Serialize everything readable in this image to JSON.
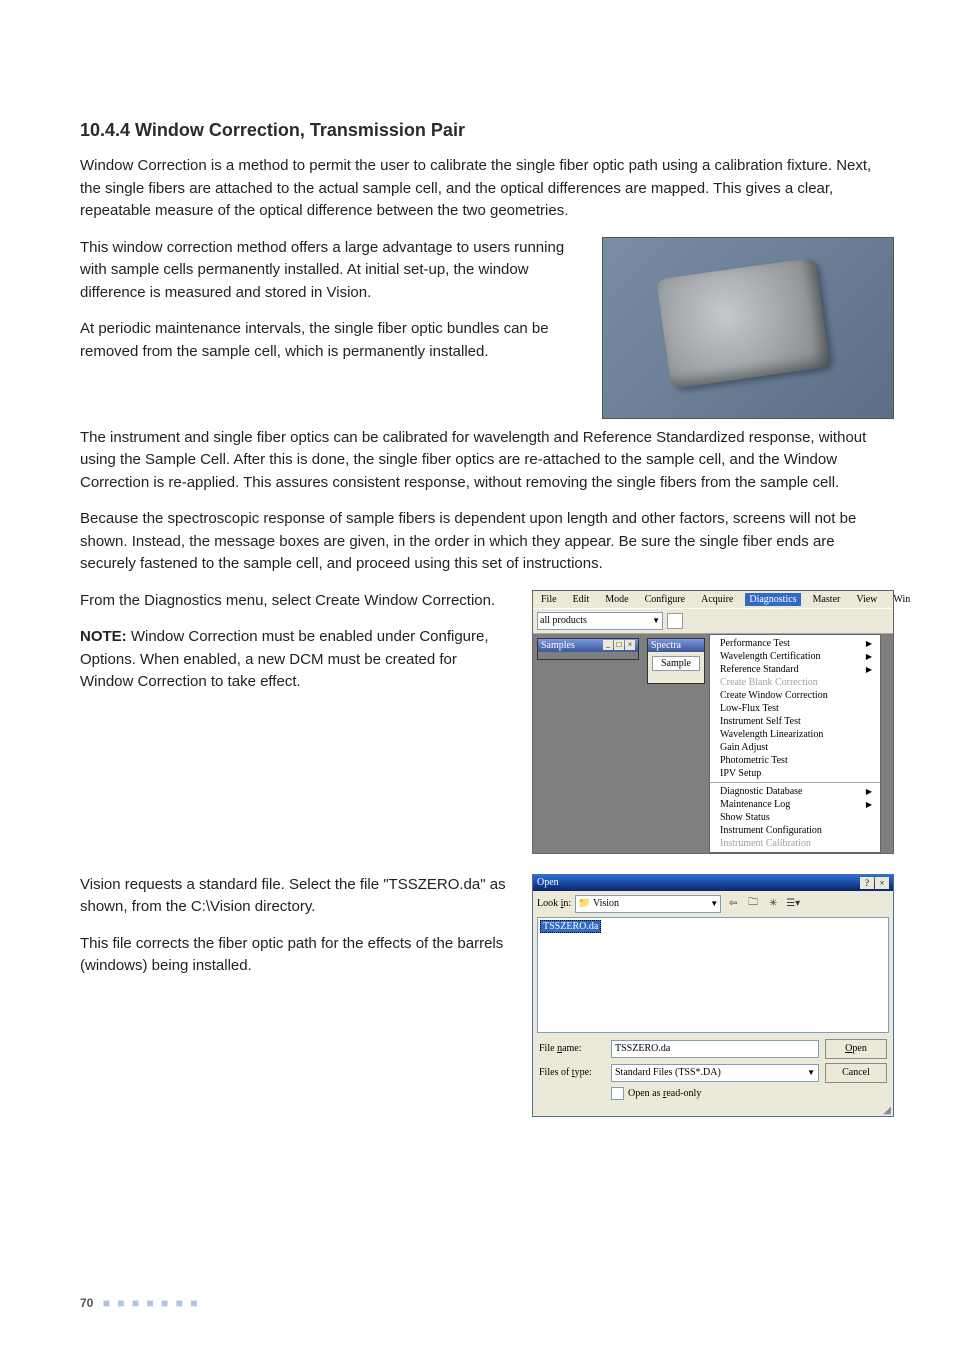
{
  "heading": "10.4.4  Window Correction, Transmission Pair",
  "para1": "Window Correction is a method to permit the user to calibrate the single fiber optic path using a calibration fixture. Next, the single fibers are attached to the actual sample cell, and the optical differences are mapped. This gives a clear, repeatable measure of the optical difference between the two geometries.",
  "para2": "This window correction method offers a large advantage to users running with sample cells permanently installed. At initial set-up, the window difference is measured and stored in Vision.",
  "para3": "At periodic maintenance intervals, the single fiber optic bundles can be removed from the sample cell, which is permanently installed.",
  "para4": "The instrument and single fiber optics can be calibrated for wavelength and Reference Standardized response, without using the Sample Cell. After this is done, the single fiber optics are re-attached to the sample cell, and the Window Correction is re-applied. This assures consistent response, without removing the single fibers from the sample cell.",
  "para5": "Because the spectroscopic response of sample fibers is dependent upon length and other factors, screens will not be shown. Instead, the message boxes are given, in the order in which they appear. Be sure the single fiber ends are securely fastened to the sample cell, and proceed using this set of instructions.",
  "para6": "From the Diagnostics menu, select Create Window Correction.",
  "note_label": "NOTE:",
  "note_body": " Window Correction must be enabled under Configure, Options. When enabled, a new DCM must be created for Window Correction to take effect.",
  "para7": "Vision requests a standard file. Select the file \"TSSZERO.da\" as shown, from the C:\\Vision directory.",
  "para8": "This file corrects the fiber optic path for the effects of the barrels (windows) being installed.",
  "menushot": {
    "menubar": [
      "File",
      "Edit",
      "Mode",
      "Configure",
      "Acquire",
      "Diagnostics",
      "Master",
      "View",
      "Win"
    ],
    "active_menu": "Diagnostics",
    "combo": "all products",
    "mdi1_title": "Samples",
    "mdi2_title": "Spectra",
    "mdi2_tab": "Sample",
    "menu_items": [
      {
        "label": "Performance Test",
        "sub": true
      },
      {
        "label": "Wavelength Certification",
        "sub": true
      },
      {
        "label": "Reference Standard",
        "sub": true
      },
      {
        "label": "Create Blank Correction",
        "disabled": true
      },
      {
        "label": "Create Window Correction"
      },
      {
        "label": "Low-Flux Test"
      },
      {
        "label": "Instrument Self Test"
      },
      {
        "label": "Wavelength Linearization"
      },
      {
        "label": "Gain Adjust"
      },
      {
        "label": "Photometric Test"
      },
      {
        "label": "IPV Setup"
      },
      {
        "sep": true
      },
      {
        "label": "Diagnostic Database",
        "sub": true
      },
      {
        "label": "Maintenance Log",
        "sub": true
      },
      {
        "label": "Show Status"
      },
      {
        "label": "Instrument Configuration"
      },
      {
        "label": "Instrument Calibration",
        "disabled": true
      }
    ]
  },
  "dlg": {
    "title": "Open",
    "lookin_label": "Look in:",
    "lookin_value": "Vision",
    "file_item": "TSSZERO.da",
    "filename_label": "File name:",
    "filename_value": "TSSZERO.da",
    "filetype_label": "Files of type:",
    "filetype_value": "Standard Files (TSS*.DA)",
    "open_btn": "Open",
    "cancel_btn": "Cancel",
    "readonly_label": "Open as read-only"
  },
  "footer_page": "70",
  "footer_dots": "■ ■ ■ ■ ■ ■ ■"
}
